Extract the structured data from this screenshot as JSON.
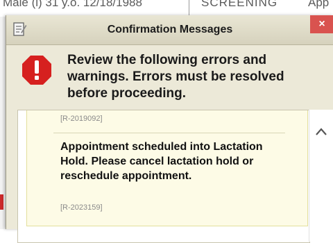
{
  "background": {
    "patient_info": "Male (i)  31 y.o.  12/18/1988",
    "status_text": "SCREENING",
    "appt_text": "App"
  },
  "dialog": {
    "title": "Confirmation Messages",
    "close_label": "×",
    "header_message": "Review the following errors and warnings. Errors must be resolved before proceeding.",
    "items": [
      {
        "code": "[R-2019092]"
      },
      {
        "message": "Appointment scheduled into Lactation Hold. Please cancel lactation hold or reschedule appointment.",
        "code": "[R-2023159]"
      }
    ]
  },
  "colors": {
    "error_red": "#d6201f",
    "close_red": "#d9534f",
    "dialog_bg": "#ece9d8",
    "item_bg": "#fdfbe6"
  },
  "icons": {
    "title": "notepad-icon",
    "error": "error-octagon-icon",
    "scroll": "chevron-up-icon"
  }
}
